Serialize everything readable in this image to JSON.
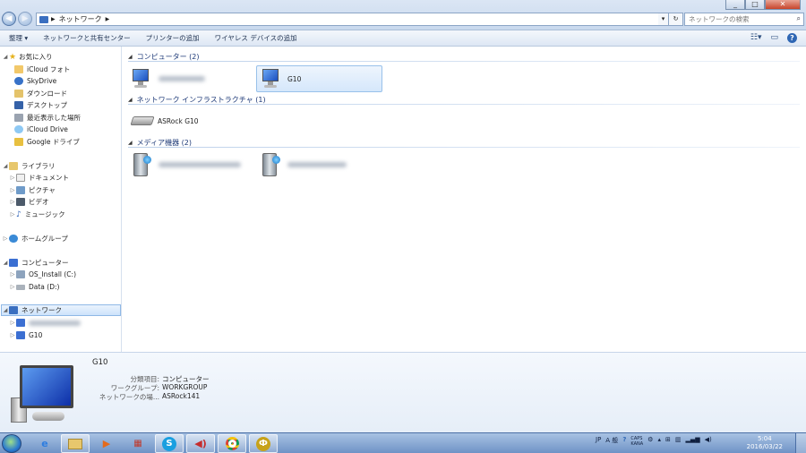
{
  "window": {
    "controls": [
      "_",
      "□",
      "✕"
    ]
  },
  "address": {
    "crumbs": [
      "ネットワーク"
    ],
    "search_placeholder": "ネットワークの検索"
  },
  "toolbar": {
    "organize": "整理 ▾",
    "network_center": "ネットワークと共有センター",
    "add_printer": "プリンターの追加",
    "add_wireless": "ワイヤレス デバイスの追加"
  },
  "nav": {
    "favorites": "お気に入り",
    "icloud_photo": "iCloud フォト",
    "skydrive": "SkyDrive",
    "downloads": "ダウンロード",
    "desktop": "デスクトップ",
    "recent": "最近表示した場所",
    "icloud_drive": "iCloud Drive",
    "google_drive": "Google ドライブ",
    "libraries": "ライブラリ",
    "documents": "ドキュメント",
    "pictures": "ピクチャ",
    "videos": "ビデオ",
    "music": "ミュージック",
    "homegroup": "ホームグループ",
    "computer": "コンピューター",
    "drive_c": "OS_Install (C:)",
    "drive_d": "Data (D:)",
    "network": "ネットワーク",
    "network_g10": "G10"
  },
  "content": {
    "group_computers": "コンピューター (2)",
    "group_infra": "ネットワーク インフラストラクチャ (1)",
    "group_media": "メディア機器 (2)",
    "computer_g10": "G10",
    "router": "ASRock G10"
  },
  "details": {
    "name": "G10",
    "rows": [
      {
        "key": "分類項目:",
        "value": "コンピューター"
      },
      {
        "key": "ワークグループ:",
        "value": "WORKGROUP"
      },
      {
        "key": "ネットワークの場...",
        "value": "ASRock141"
      }
    ]
  },
  "taskbar": {
    "lang": "JP",
    "ime": "A 般",
    "caps": "CAPS\nKANA",
    "time": "5:04",
    "date": "2016/03/22"
  }
}
